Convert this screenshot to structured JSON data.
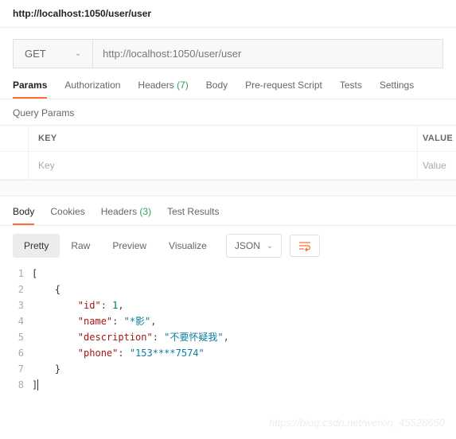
{
  "header": {
    "title": "http://localhost:1050/user/user"
  },
  "request": {
    "method": "GET",
    "url": "http://localhost:1050/user/user"
  },
  "tabs": {
    "params": "Params",
    "authorization": "Authorization",
    "headers": "Headers",
    "headers_count": "(7)",
    "body": "Body",
    "prerequest": "Pre-request Script",
    "tests": "Tests",
    "settings": "Settings"
  },
  "query": {
    "label": "Query Params",
    "col_key": "KEY",
    "col_value": "VALUE",
    "ph_key": "Key",
    "ph_value": "Value"
  },
  "resp_tabs": {
    "body": "Body",
    "cookies": "Cookies",
    "headers": "Headers",
    "headers_count": "(3)",
    "test_results": "Test Results"
  },
  "view": {
    "pretty": "Pretty",
    "raw": "Raw",
    "preview": "Preview",
    "visualize": "Visualize",
    "format": "JSON"
  },
  "code": {
    "l1": "[",
    "l2_indent": "    ",
    "l2": "{",
    "l3_indent": "        ",
    "l3_k": "\"id\"",
    "l3_c": ": ",
    "l3_v": "1",
    "l3_t": ",",
    "l4_k": "\"name\"",
    "l4_c": ": ",
    "l4_v": "\"*影\"",
    "l4_t": ",",
    "l5_k": "\"description\"",
    "l5_c": ": ",
    "l5_v": "\"不要怀疑我\"",
    "l5_t": ",",
    "l6_k": "\"phone\"",
    "l6_c": ": ",
    "l6_v": "\"153****7574\"",
    "l7": "}",
    "l8": "]"
  },
  "watermark": "https://blog.csdn.net/weixin_45528650"
}
